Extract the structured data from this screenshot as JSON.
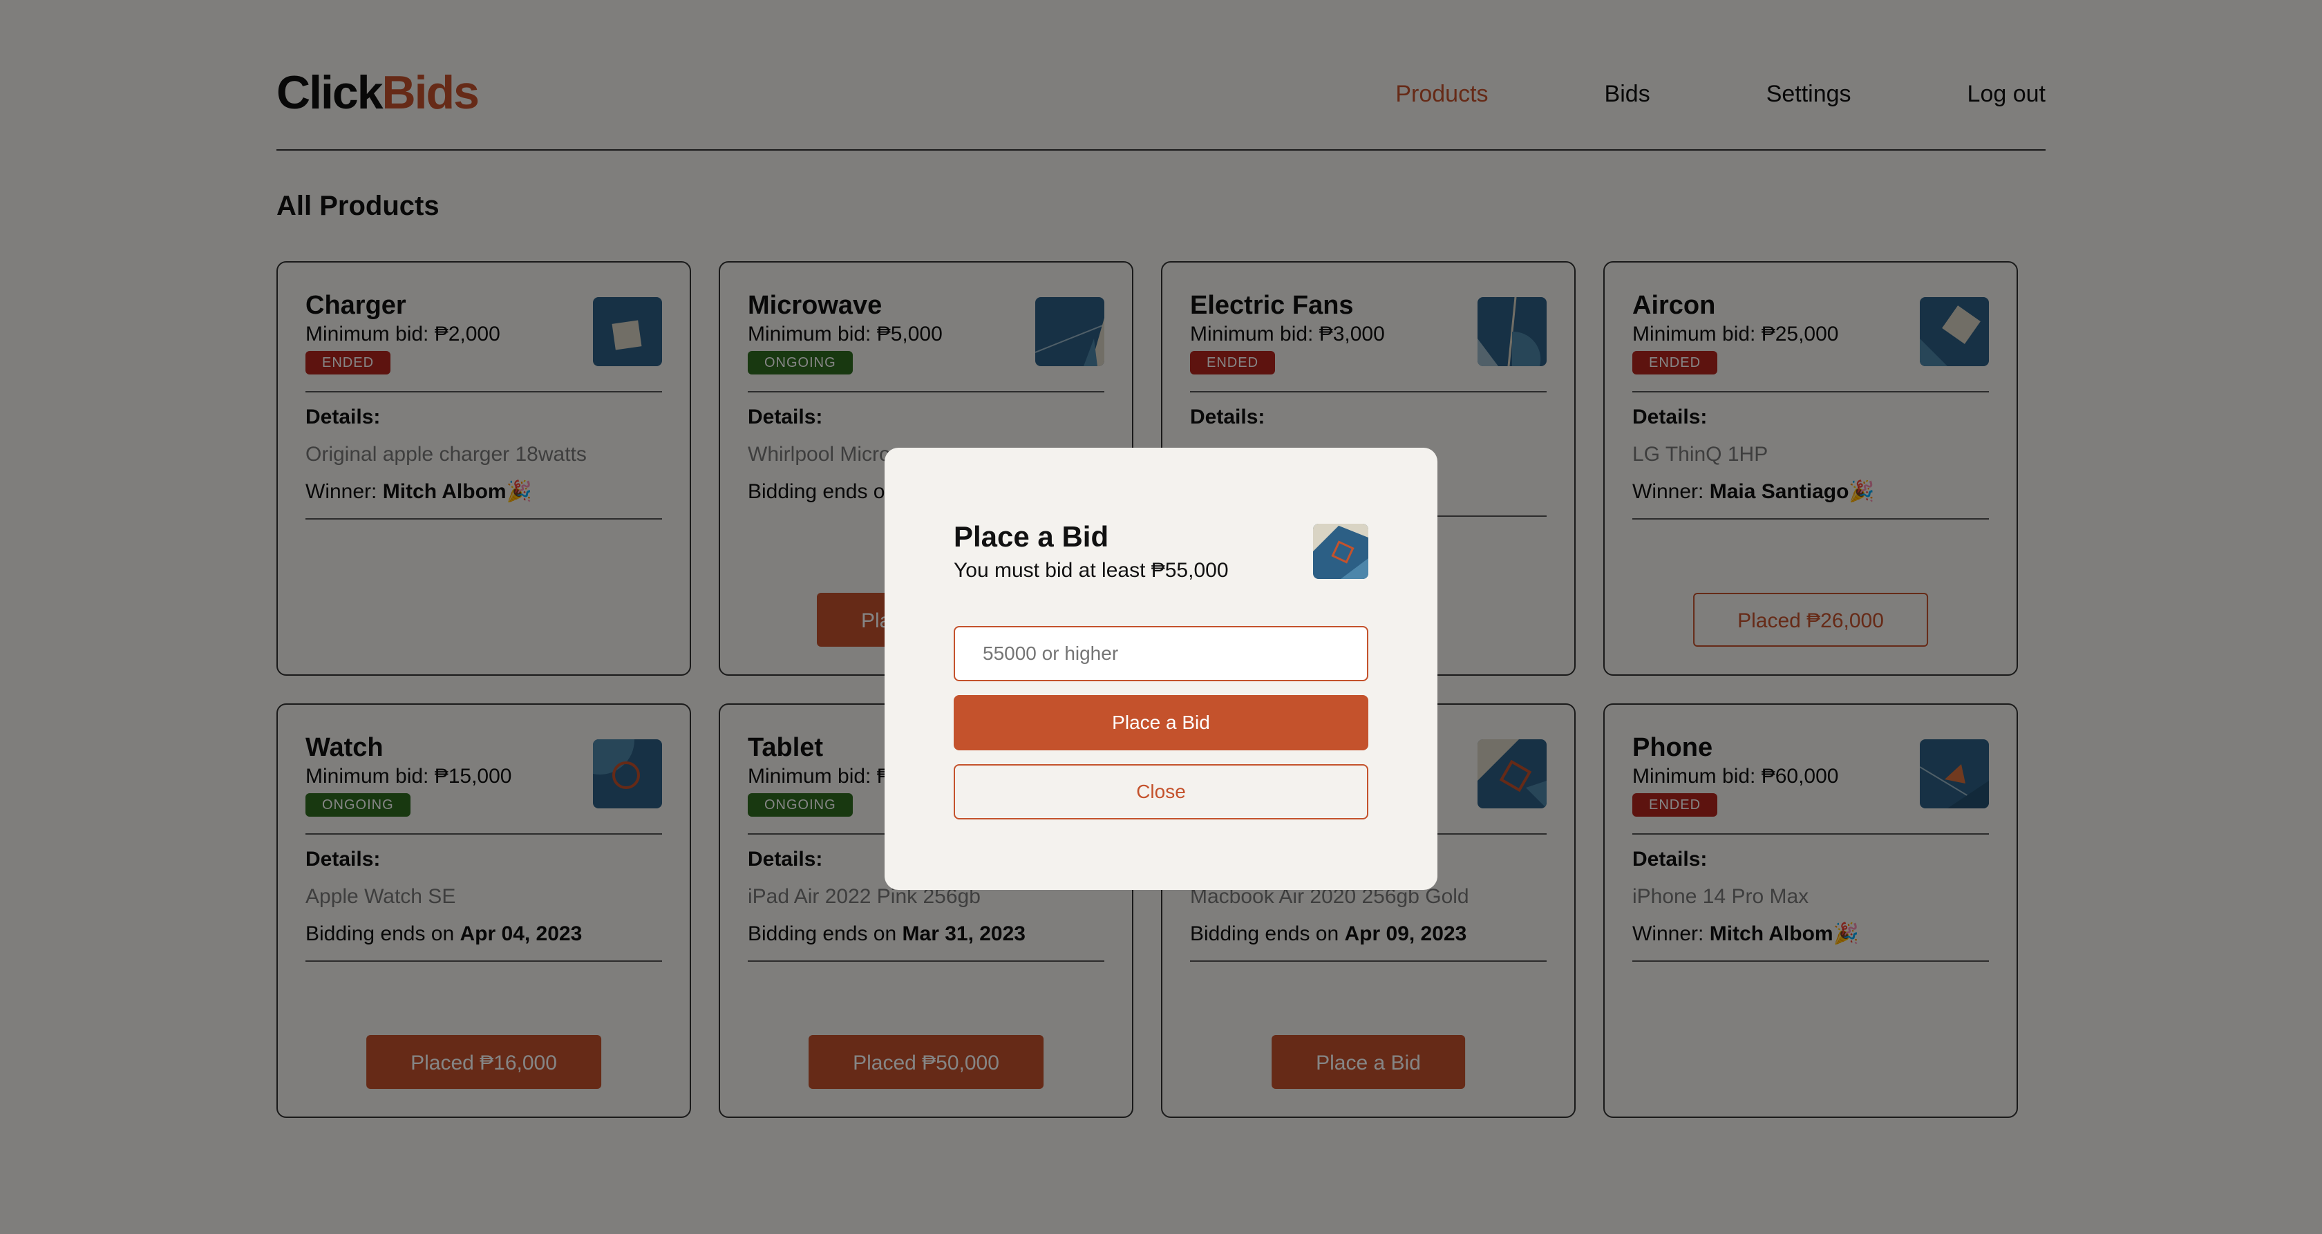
{
  "brand": {
    "part1": "Click",
    "part2": "Bids"
  },
  "nav": {
    "products": "Products",
    "bids": "Bids",
    "settings": "Settings",
    "logout": "Log out"
  },
  "section_title": "All Products",
  "products": [
    {
      "title": "Charger",
      "minbid": "Minimum bid: ₱2,000",
      "status": "ENDED",
      "details_label": "Details:",
      "details": "Original apple charger 18watts",
      "line3_prefix": "Winner: ",
      "line3_value": "Mitch Albom",
      "line3_suffix": "🎉",
      "action": ""
    },
    {
      "title": "Microwave",
      "minbid": "Minimum bid: ₱5,000",
      "status": "ONGOING",
      "details_label": "Details:",
      "details": "Whirlpool Micro",
      "line3_prefix": "Bidding ends o",
      "line3_value": "",
      "line3_suffix": "",
      "action": "Pla"
    },
    {
      "title": "Electric Fans",
      "minbid": "Minimum bid: ₱3,000",
      "status": "ENDED",
      "details_label": "Details:",
      "details": "",
      "line3_prefix": "",
      "line3_value": "",
      "line3_suffix": "",
      "action": ""
    },
    {
      "title": "Aircon",
      "minbid": "Minimum bid: ₱25,000",
      "status": "ENDED",
      "details_label": "Details:",
      "details": "LG ThinQ 1HP",
      "line3_prefix": "Winner: ",
      "line3_value": "Maia Santiago",
      "line3_suffix": "🎉",
      "action": "Placed ₱26,000"
    },
    {
      "title": "Watch",
      "minbid": "Minimum bid: ₱15,000",
      "status": "ONGOING",
      "details_label": "Details:",
      "details": "Apple Watch SE",
      "line3_prefix": "Bidding ends on ",
      "line3_value": "Apr 04, 2023",
      "line3_suffix": "",
      "action": "Placed ₱16,000"
    },
    {
      "title": "Tablet",
      "minbid": "Minimum bid: ₱",
      "status": "ONGOING",
      "details_label": "Details:",
      "details": "iPad Air 2022 Pink 256gb",
      "line3_prefix": "Bidding ends on ",
      "line3_value": "Mar 31, 2023",
      "line3_suffix": "",
      "action": "Placed ₱50,000"
    },
    {
      "title": "",
      "minbid": "",
      "status": "",
      "details_label": "",
      "details": "Macbook Air 2020 256gb Gold",
      "line3_prefix": "Bidding ends on ",
      "line3_value": "Apr 09, 2023",
      "line3_suffix": "",
      "action": "Place a Bid"
    },
    {
      "title": "Phone",
      "minbid": "Minimum bid: ₱60,000",
      "status": "ENDED",
      "details_label": "Details:",
      "details": "iPhone 14 Pro Max",
      "line3_prefix": "Winner: ",
      "line3_value": "Mitch Albom",
      "line3_suffix": "🎉",
      "action": ""
    }
  ],
  "modal": {
    "title": "Place a Bid",
    "subtitle": "You must bid at least ₱55,000",
    "input_placeholder": "55000 or higher",
    "submit_label": "Place a Bid",
    "close_label": "Close"
  },
  "colors": {
    "accent": "#c4522c",
    "ended": "#b3261e",
    "ongoing": "#2f6b1f",
    "thumb": "#2c5f85"
  }
}
